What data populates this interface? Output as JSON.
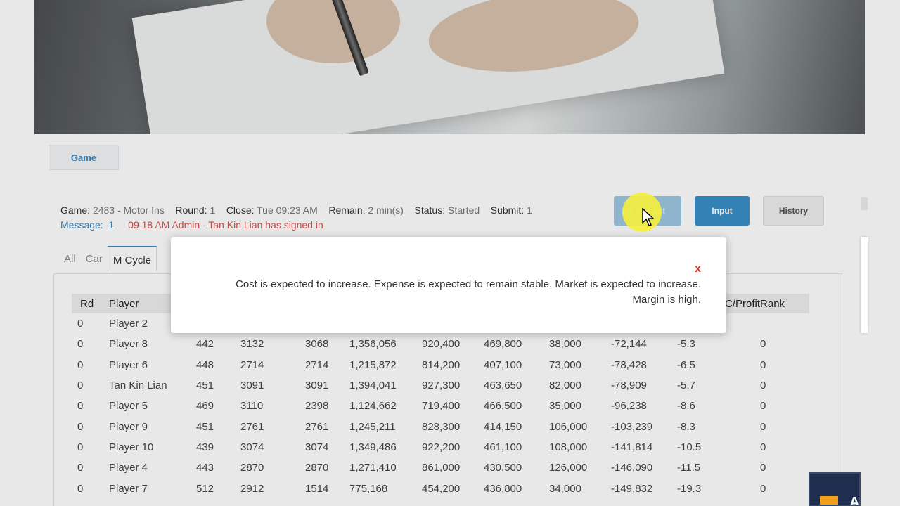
{
  "game_tab": "Game",
  "info": {
    "game_label": "Game:",
    "game_value": "2483 -  Motor Ins",
    "round_label": "Round:",
    "round_value": "1",
    "close_label": "Close:",
    "close_value": "Tue 09:23 AM",
    "remain_label": "Remain:",
    "remain_value": "2 min(s)",
    "status_label": "Status:",
    "status_value": "Started",
    "submit_label": "Submit:",
    "submit_value": "1"
  },
  "message": {
    "label": "Message:",
    "count": "1",
    "text": "09 18 AM Admin - Tan Kin Lian has signed in"
  },
  "buttons": {
    "forecast": "Forecast",
    "input": "Input",
    "history": "History"
  },
  "subtabs": [
    "All",
    "Car",
    "M Cycle"
  ],
  "table": {
    "headers": [
      "Rd",
      "Player",
      "",
      "",
      "",
      "",
      "",
      "",
      "",
      "",
      "C/Profit",
      "Rank"
    ],
    "rows": [
      [
        "0",
        "Player 2",
        "",
        "",
        "",
        "",
        "",
        "",
        "",
        "",
        "",
        ""
      ],
      [
        "0",
        "Player 8",
        "442",
        "3132",
        "3068",
        "1,356,056",
        "920,400",
        "469,800",
        "38,000",
        "-72,144",
        "-5.3",
        "0"
      ],
      [
        "0",
        "Player 6",
        "448",
        "2714",
        "2714",
        "1,215,872",
        "814,200",
        "407,100",
        "73,000",
        "-78,428",
        "-6.5",
        "0"
      ],
      [
        "0",
        "Tan Kin Lian",
        "451",
        "3091",
        "3091",
        "1,394,041",
        "927,300",
        "463,650",
        "82,000",
        "-78,909",
        "-5.7",
        "0"
      ],
      [
        "0",
        "Player 5",
        "469",
        "3110",
        "2398",
        "1,124,662",
        "719,400",
        "466,500",
        "35,000",
        "-96,238",
        "-8.6",
        "0"
      ],
      [
        "0",
        "Player 9",
        "451",
        "2761",
        "2761",
        "1,245,211",
        "828,300",
        "414,150",
        "106,000",
        "-103,239",
        "-8.3",
        "0"
      ],
      [
        "0",
        "Player 10",
        "439",
        "3074",
        "3074",
        "1,349,486",
        "922,200",
        "461,100",
        "108,000",
        "-141,814",
        "-10.5",
        "0"
      ],
      [
        "0",
        "Player 4",
        "443",
        "2870",
        "2870",
        "1,271,410",
        "861,000",
        "430,500",
        "126,000",
        "-146,090",
        "-11.5",
        "0"
      ],
      [
        "0",
        "Player 7",
        "512",
        "2912",
        "1514",
        "775,168",
        "454,200",
        "436,800",
        "34,000",
        "-149,832",
        "-19.3",
        "0"
      ]
    ]
  },
  "modal": {
    "close": "x",
    "line1": "Cost is expected to increase. Expense is expected to remain stable. Market is expected to increase.",
    "line2": "Margin is high."
  },
  "badge_text": "AV"
}
